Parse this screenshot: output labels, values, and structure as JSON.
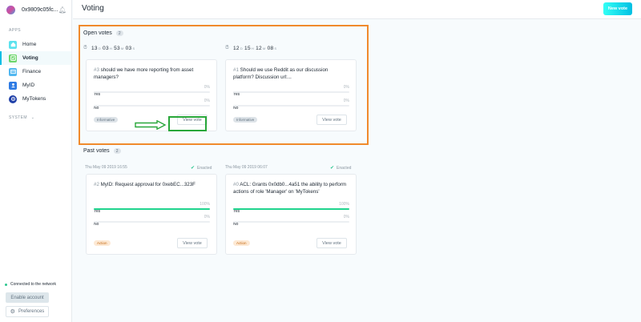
{
  "account": {
    "address": "0x9809c05fc..."
  },
  "sidebar": {
    "apps_label": "APPS",
    "items": [
      {
        "label": "Home",
        "icon": "home-icon",
        "color": "#5ce2ee"
      },
      {
        "label": "Voting",
        "icon": "voting-icon",
        "color": "#6cd66b"
      },
      {
        "label": "Finance",
        "icon": "finance-icon",
        "color": "#4fb6f0"
      },
      {
        "label": "MyID",
        "icon": "myid-icon",
        "color": "#2e7be4"
      },
      {
        "label": "MyTokens",
        "icon": "mytokens-icon",
        "color": "#1f3fa8"
      }
    ],
    "system_label": "SYSTEM",
    "network_status": "Connected to the network",
    "enable_account": "Enable account",
    "preferences": "Preferences"
  },
  "header": {
    "title": "Voting",
    "new_vote": "New vote"
  },
  "open_votes": {
    "title": "Open votes",
    "count": "2",
    "cards": [
      {
        "timer": {
          "days": "13",
          "hours": "03",
          "minutes": "53",
          "seconds": "03"
        },
        "number": "#3",
        "question": "should we have more reporting from asset managers?",
        "yes_label": "Yes",
        "yes_pct": "0%",
        "yes_value": 0,
        "no_label": "No",
        "no_pct": "0%",
        "no_value": 0,
        "tag": "Informative",
        "button": "View vote"
      },
      {
        "timer": {
          "days": "12",
          "hours": "15",
          "minutes": "12",
          "seconds": "08"
        },
        "number": "#1",
        "question": "Should we use Reddit as our discussion platform? Discussion url:...",
        "yes_label": "Yes",
        "yes_pct": "0%",
        "yes_value": 0,
        "no_label": "No",
        "no_pct": "0%",
        "no_value": 0,
        "tag": "Informative",
        "button": "View vote"
      }
    ]
  },
  "past_votes": {
    "title": "Past votes",
    "count": "2",
    "cards": [
      {
        "date": "Thu May 09 2019 16:55",
        "status": "Enacted",
        "number": "#2",
        "question": "MyID: Request approval for 0xebEC...323F",
        "yes_label": "Yes",
        "yes_pct": "100%",
        "yes_value": 1,
        "no_label": "No",
        "no_pct": "0%",
        "no_value": 0,
        "tag": "Action",
        "button": "View vote"
      },
      {
        "date": "Thu May 09 2019 06:07",
        "status": "Enacted",
        "number": "#0",
        "question": "ACL: Grants 0x0db0...4a51 the ability to perform actions of role 'Manager' on 'MyTokens'",
        "yes_label": "Yes",
        "yes_pct": "100%",
        "yes_value": 1,
        "no_label": "No",
        "no_pct": "0%",
        "no_value": 0,
        "tag": "Action",
        "button": "View vote"
      }
    ]
  },
  "timer_units": {
    "d": "D",
    "h": "H",
    "m": "M",
    "s": "S"
  },
  "colors": {
    "accent": "#08bee5",
    "highlight": "#f08a2c",
    "green_box": "#29a73a",
    "bar_fill": "#21d48e"
  }
}
